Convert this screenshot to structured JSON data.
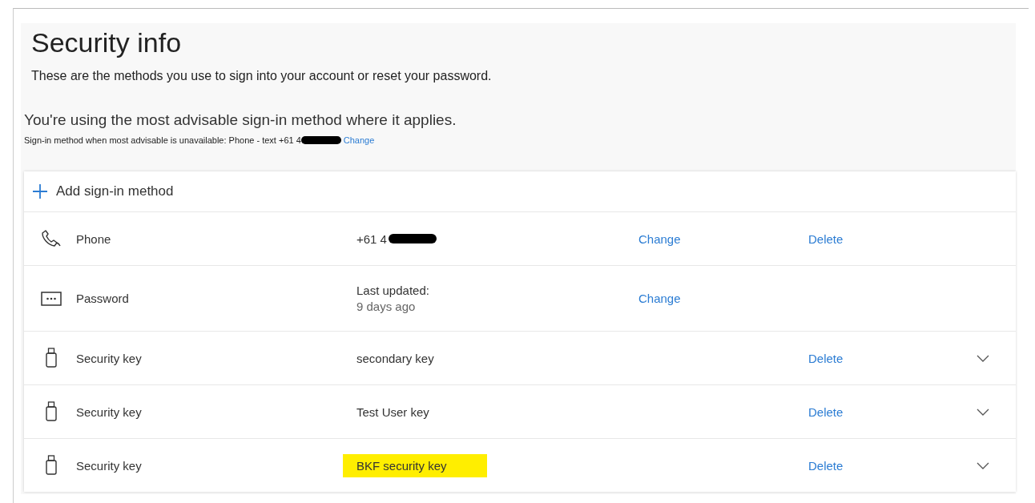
{
  "title": "Security info",
  "subtitle": "These are the methods you use to sign into your account or reset your password.",
  "status": {
    "heading": "You're using the most advisable sign-in method where it applies.",
    "fallback": "Sign-in method when most advisable is unavailable: Phone - text +61 4",
    "redacted": true,
    "link": "Change"
  },
  "add_method": "Add sign-in method",
  "methods": [
    {
      "kind": "phone",
      "name": "Phone",
      "value": "+61 4",
      "redacted": true,
      "change": "Change",
      "delete": "Delete",
      "expandable": false,
      "highlighted": false
    },
    {
      "kind": "password",
      "name": "Password",
      "value": "Last updated:",
      "detail": "9 days ago",
      "redacted": false,
      "change": "Change",
      "expandable": false,
      "highlighted": false
    },
    {
      "kind": "key",
      "name": "Security key",
      "value": "secondary key",
      "redacted": false,
      "delete": "Delete",
      "expandable": true,
      "highlighted": false
    },
    {
      "kind": "key",
      "name": "Security key",
      "value": "Test User key",
      "redacted": false,
      "delete": "Delete",
      "expandable": true,
      "highlighted": false
    },
    {
      "kind": "key",
      "name": "Security key",
      "value": "BKF security key",
      "redacted": false,
      "delete": "Delete",
      "expandable": true,
      "highlighted": true
    }
  ]
}
